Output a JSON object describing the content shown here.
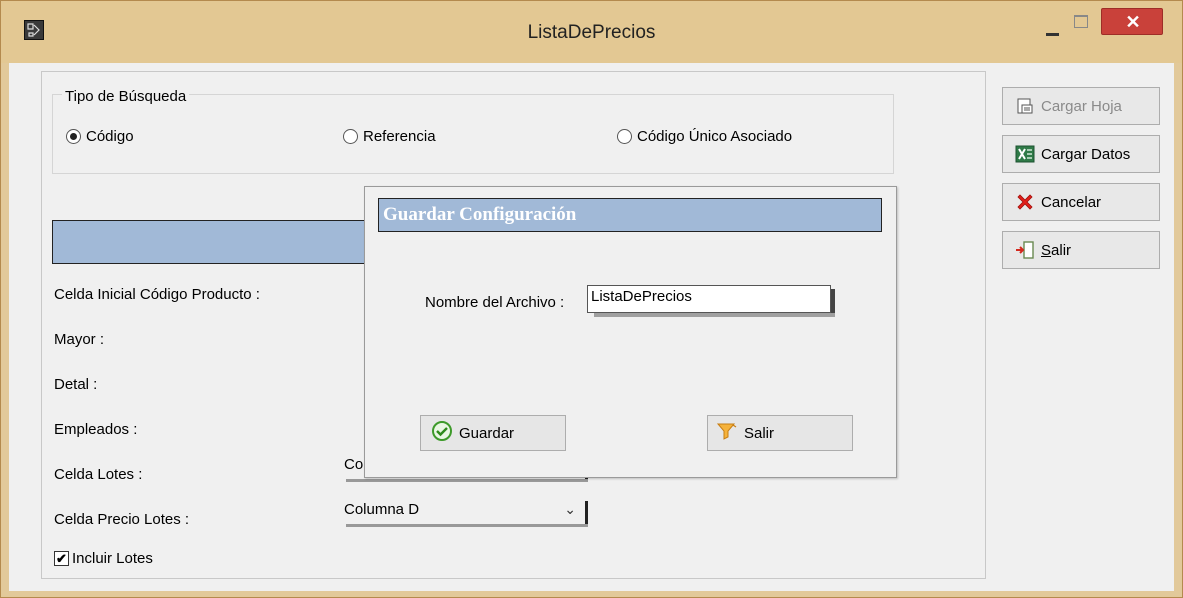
{
  "window": {
    "title": "ListaDePrecios",
    "close_glyph": "✕"
  },
  "search_type": {
    "legend": "Tipo de Búsqueda",
    "options": [
      {
        "label": "Código",
        "selected": true
      },
      {
        "label": "Referencia",
        "selected": false
      },
      {
        "label": "Código Único Asociado",
        "selected": false
      }
    ]
  },
  "fields": {
    "codigo_producto": "Celda Inicial Código Producto :",
    "mayor": "Mayor :",
    "detal": "Detal :",
    "empleados": "Empleados :",
    "celda_lotes": "Celda Lotes :",
    "celda_precio_lotes": "Celda Precio Lotes :"
  },
  "combos": {
    "celda_lotes_value": "Columna C",
    "celda_precio_lotes_value": "Columna D",
    "arrow": "⌄"
  },
  "include_lots": {
    "label": "Incluir Lotes",
    "checked": true,
    "mark": "✔"
  },
  "side_buttons": {
    "cargar_hoja": "Cargar Hoja",
    "cargar_datos": "Cargar Datos",
    "cancelar": "Cancelar",
    "salir": "Salir"
  },
  "dialog": {
    "title": "Guardar Configuración",
    "file_label": "Nombre del Archivo :",
    "file_value": "ListaDePrecios",
    "save_label": "Guardar",
    "exit_label": "Salir"
  },
  "colors": {
    "title_bar": "#e3c893",
    "header_blue": "#a1b9d7",
    "close_red": "#c9413a"
  }
}
